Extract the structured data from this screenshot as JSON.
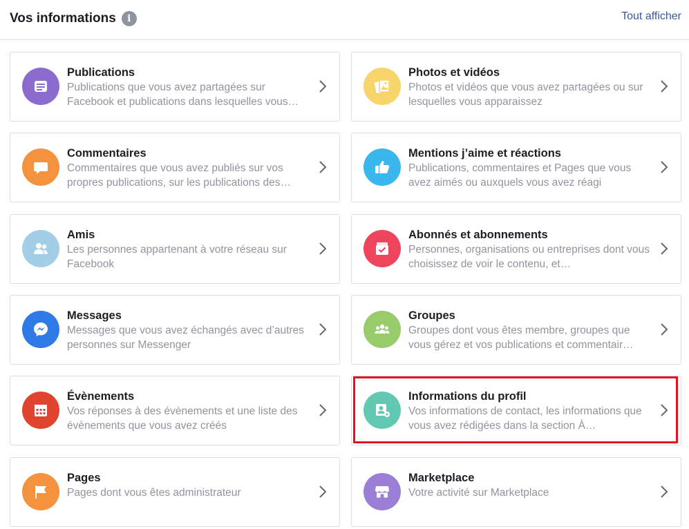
{
  "header": {
    "title": "Vos informations",
    "info_icon": "i",
    "see_all": "Tout afficher"
  },
  "colors": {
    "publications": "#8c6bcf",
    "photos": "#f7d56a",
    "comments": "#f5923e",
    "likes": "#3ab7ec",
    "friends": "#a3cfe6",
    "followers": "#ee445c",
    "messages": "#2e7be8",
    "groups": "#98cc6a",
    "events": "#e0442f",
    "profile": "#61c9b1",
    "pages": "#f5923e",
    "marketplace": "#9b7fd6",
    "highlight": "#e3141d",
    "link": "#385898"
  },
  "cards": [
    {
      "title": "Publications",
      "desc": "Publications que vous avez partagées sur Facebook et publications dans lesquelles vous…",
      "icon": "document-icon"
    },
    {
      "title": "Photos et vidéos",
      "desc": "Photos et vidéos que vous avez partagées ou sur lesquelles vous apparaissez",
      "icon": "photo-icon"
    },
    {
      "title": "Commentaires",
      "desc": "Commentaires que vous avez publiés sur vos propres publications, sur les publications des…",
      "icon": "comment-icon"
    },
    {
      "title": "Mentions j’aime et réactions",
      "desc": "Publications, commentaires et Pages que vous avez aimés ou auxquels vous avez réagi",
      "icon": "thumbs-up-icon"
    },
    {
      "title": "Amis",
      "desc": "Les personnes appartenant à votre réseau sur Facebook",
      "icon": "friends-icon"
    },
    {
      "title": "Abonnés et abonnements",
      "desc": "Personnes, organisations ou entreprises dont vous choisissez de voir le contenu, et…",
      "icon": "follow-icon"
    },
    {
      "title": "Messages",
      "desc": "Messages que vous avez échangés avec d’autres personnes sur Messenger",
      "icon": "messenger-icon"
    },
    {
      "title": "Groupes",
      "desc": "Groupes dont vous êtes membre, groupes que vous gérez et vos publications et commentair…",
      "icon": "groups-icon"
    },
    {
      "title": "Évènements",
      "desc": "Vos réponses à des évènements et une liste des évènements que vous avez créés",
      "icon": "calendar-icon"
    },
    {
      "title": "Informations du profil",
      "desc": "Vos informations de contact, les informations que vous avez rédigées dans la section À…",
      "icon": "profile-settings-icon"
    },
    {
      "title": "Pages",
      "desc": "Pages dont vous êtes administrateur",
      "icon": "flag-icon"
    },
    {
      "title": "Marketplace",
      "desc": "Votre activité sur Marketplace",
      "icon": "shop-icon"
    }
  ]
}
